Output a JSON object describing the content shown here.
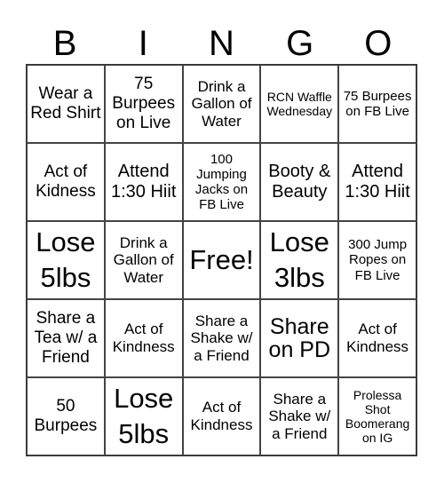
{
  "header": {
    "letters": [
      "B",
      "I",
      "N",
      "G",
      "O"
    ]
  },
  "cells": [
    "Wear a Red Shirt",
    "75 Burpees on Live",
    "Drink a Gallon of Water",
    "RCN Waffle Wednesday",
    "75 Burpees on FB Live",
    "Act of Kidness",
    "Attend 1:30 Hiit",
    "100 Jumping Jacks on FB Live",
    "Booty & Beauty",
    "Attend 1:30 Hiit",
    "Lose 5lbs",
    "Drink a Gallon of Water",
    "Free!",
    "Lose 3lbs",
    "300 Jump Ropes on FB Live",
    "Share a Tea w/ a Friend",
    "Act of Kindness",
    "Share a Shake w/ a Friend",
    "Share on PD",
    "Act of Kindness",
    "50 Burpees",
    "Lose 5lbs",
    "Act of Kindness",
    "Share a Shake w/ a Friend",
    "Prolessa Shot Boomerang on IG"
  ]
}
